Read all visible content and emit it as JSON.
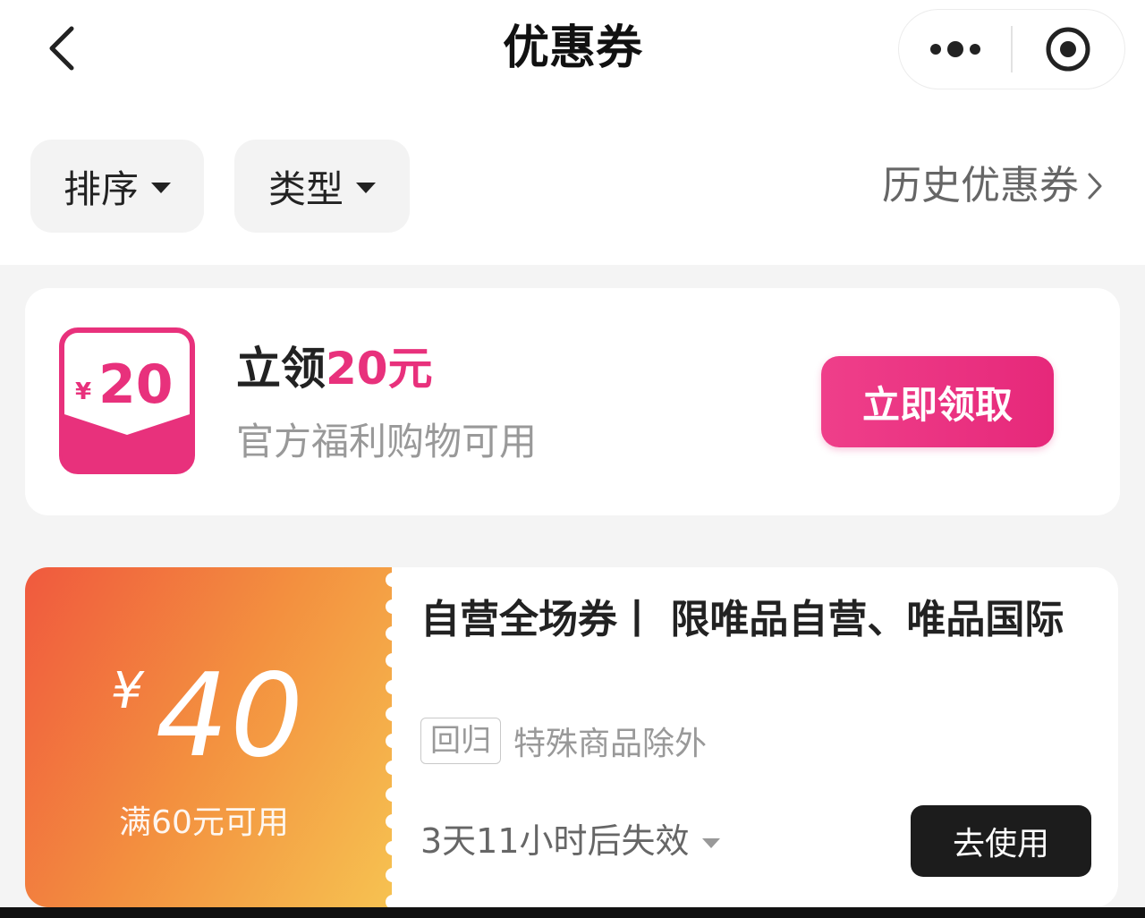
{
  "header": {
    "title": "优惠券",
    "back_icon": "chevron-left-icon",
    "more_icon": "more-dots-icon",
    "close_icon": "target-circle-icon"
  },
  "filters": {
    "sort_label": "排序",
    "type_label": "类型",
    "history_label": "历史优惠券"
  },
  "promo": {
    "icon_currency": "¥",
    "icon_amount": "20",
    "title_prefix": "立领",
    "title_amount": "20元",
    "subtitle": "官方福利购物可用",
    "button_label": "立即领取",
    "accent_color": "#e8317c"
  },
  "coupon": {
    "currency": "¥",
    "amount": "40",
    "threshold": "满60元可用",
    "title": "自营全场券丨 限唯品自营、唯品国际",
    "tag": "回归",
    "note": "特殊商品除外",
    "expiry": "3天11小时后失效",
    "button_label": "去使用"
  }
}
